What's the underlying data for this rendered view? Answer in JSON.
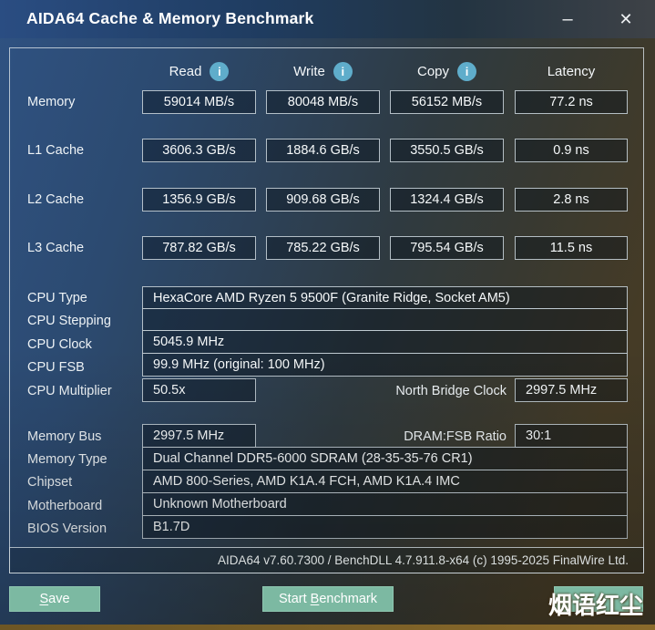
{
  "window": {
    "title": "AIDA64 Cache & Memory Benchmark",
    "minimize_glyph": "–",
    "close_glyph": "✕"
  },
  "benchmark": {
    "columns": [
      {
        "label": "Read",
        "info_glyph": "i"
      },
      {
        "label": "Write",
        "info_glyph": "i"
      },
      {
        "label": "Copy",
        "info_glyph": "i"
      },
      {
        "label": "Latency"
      }
    ],
    "rows": [
      {
        "label": "Memory",
        "read": "59014 MB/s",
        "write": "80048 MB/s",
        "copy": "56152 MB/s",
        "latency": "77.2 ns"
      },
      {
        "label": "L1 Cache",
        "read": "3606.3 GB/s",
        "write": "1884.6 GB/s",
        "copy": "3550.5 GB/s",
        "latency": "0.9 ns"
      },
      {
        "label": "L2 Cache",
        "read": "1356.9 GB/s",
        "write": "909.68 GB/s",
        "copy": "1324.4 GB/s",
        "latency": "2.8 ns"
      },
      {
        "label": "L3 Cache",
        "read": "787.82 GB/s",
        "write": "785.22 GB/s",
        "copy": "795.54 GB/s",
        "latency": "11.5 ns"
      }
    ]
  },
  "cpu": {
    "type_label": "CPU Type",
    "type_value": "HexaCore AMD Ryzen 5 9500F  (Granite Ridge, Socket AM5)",
    "stepping_label": "CPU Stepping",
    "stepping_value": "",
    "clock_label": "CPU Clock",
    "clock_value": "5045.9 MHz",
    "fsb_label": "CPU FSB",
    "fsb_value": "99.9 MHz  (original: 100 MHz)",
    "multiplier_label": "CPU Multiplier",
    "multiplier_value": "50.5x",
    "nb_clock_label": "North Bridge Clock",
    "nb_clock_value": "2997.5 MHz"
  },
  "system": {
    "memory_bus_label": "Memory Bus",
    "memory_bus_value": "2997.5 MHz",
    "dram_fsb_label": "DRAM:FSB Ratio",
    "dram_fsb_value": "30:1",
    "memory_type_label": "Memory Type",
    "memory_type_value": "Dual Channel DDR5-6000 SDRAM  (28-35-35-76 CR1)",
    "chipset_label": "Chipset",
    "chipset_value": "AMD 800-Series, AMD K1A.4 FCH, AMD K1A.4 IMC",
    "motherboard_label": "Motherboard",
    "motherboard_value": "Unknown Motherboard",
    "bios_label": "BIOS Version",
    "bios_value": "B1.7D"
  },
  "footer": {
    "version_text": "AIDA64 v7.60.7300 / BenchDLL 4.7.911.8-x64  (c) 1995-2025 FinalWire Ltd."
  },
  "buttons": {
    "save": {
      "mnemonic": "S",
      "rest": "ave"
    },
    "start": {
      "prefix": "Start ",
      "mnemonic": "B",
      "rest": "enchmark"
    }
  },
  "watermark": "烟语红尘",
  "colors": {
    "accent_button": "#7cb9a2",
    "info_icon": "#5fadcb",
    "titlebar_blue": "#2a4d82",
    "bottom_strip": "#7a5f26"
  }
}
